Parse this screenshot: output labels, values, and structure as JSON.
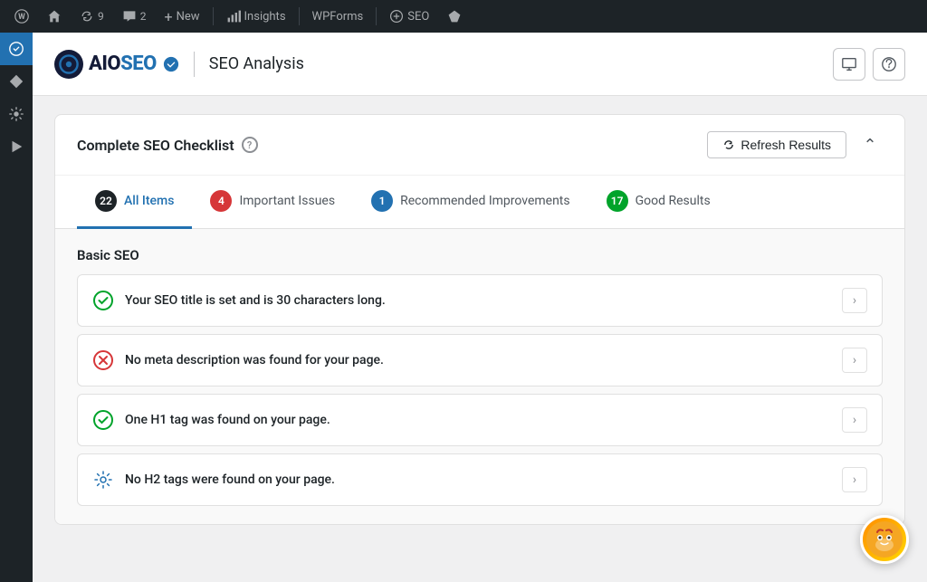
{
  "adminBar": {
    "items": [
      {
        "id": "wp-logo",
        "label": "WordPress",
        "icon": "wp"
      },
      {
        "id": "home",
        "label": "Home",
        "icon": "home"
      },
      {
        "id": "updates",
        "label": "9",
        "icon": "refresh"
      },
      {
        "id": "comments",
        "label": "2",
        "icon": "comment"
      },
      {
        "id": "new",
        "label": "New",
        "icon": "plus"
      },
      {
        "id": "insights",
        "label": "Insights",
        "icon": "chart"
      },
      {
        "id": "wpforms",
        "label": "WPForms",
        "icon": ""
      },
      {
        "id": "seo",
        "label": "SEO",
        "icon": "seo"
      }
    ]
  },
  "header": {
    "brand": "AIOSEO",
    "page_title": "SEO Analysis"
  },
  "checklist": {
    "title": "Complete SEO Checklist",
    "refresh_label": "Refresh Results",
    "help_label": "?",
    "tabs": [
      {
        "id": "all",
        "label": "All Items",
        "count": "22",
        "badge_class": "badge-dark",
        "active": true
      },
      {
        "id": "issues",
        "label": "Important Issues",
        "count": "4",
        "badge_class": "badge-red",
        "active": false
      },
      {
        "id": "improvements",
        "label": "Recommended Improvements",
        "count": "1",
        "badge_class": "badge-blue",
        "active": false
      },
      {
        "id": "good",
        "label": "Good Results",
        "count": "17",
        "badge_class": "badge-green",
        "active": false
      }
    ],
    "section_title": "Basic SEO",
    "items": [
      {
        "id": "seo-title",
        "text": "Your SEO title is set and is 30 characters long.",
        "status": "success"
      },
      {
        "id": "meta-desc",
        "text": "No meta description was found for your page.",
        "status": "error"
      },
      {
        "id": "h1-tag",
        "text": "One H1 tag was found on your page.",
        "status": "success"
      },
      {
        "id": "h2-tag",
        "text": "No H2 tags were found on your page.",
        "status": "info"
      }
    ]
  }
}
